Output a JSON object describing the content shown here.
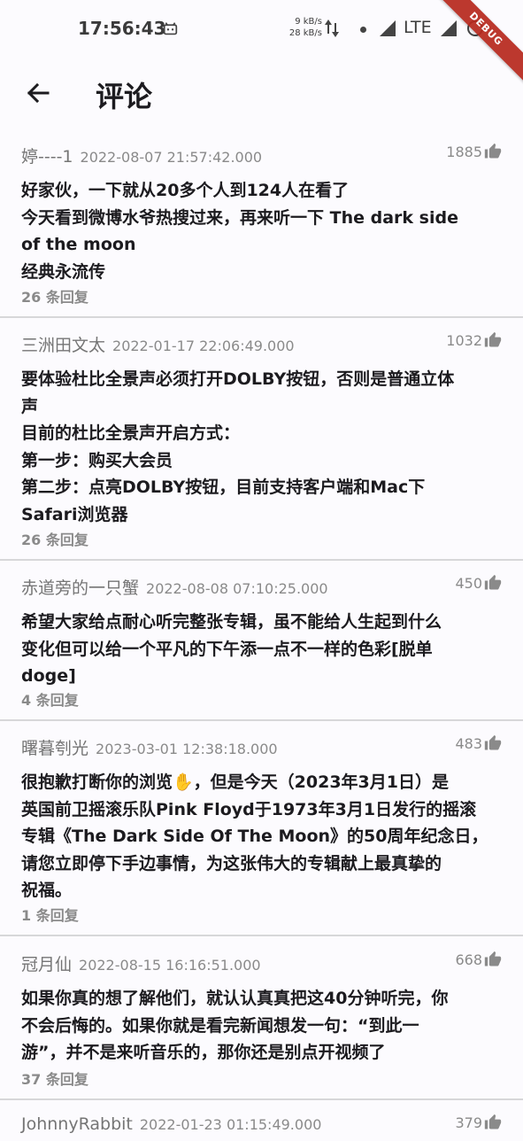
{
  "status_bar": {
    "time": "17:56:43",
    "speed_up": "9 kB/s",
    "speed_down": "28 kB/s",
    "network": "LTE"
  },
  "debug_banner": "DEBUG",
  "header": {
    "title": "评论"
  },
  "comments": [
    {
      "author": "婷----1",
      "date": "2022-08-07 21:57:42.000",
      "likes": "1885",
      "lines": [
        "好家伙，一下就从20多个人到124人在看了",
        "今天看到微博水爷热搜过来，再来听一下 The dark side",
        "of the moon",
        "经典永流传"
      ],
      "replies": "26 条回复"
    },
    {
      "author": "三洲田文太",
      "date": "2022-01-17 22:06:49.000",
      "likes": "1032",
      "lines": [
        "要体验杜比全景声必须打开DOLBY按钮，否则是普通立体",
        "声",
        "目前的杜比全景声开启方式：",
        "第一步：购买大会员",
        "第二步：点亮DOLBY按钮，目前支持客户端和Mac下",
        "Safari浏览器"
      ],
      "replies": "26 条回复"
    },
    {
      "author": "赤道旁的一只蟹",
      "date": "2022-08-08 07:10:25.000",
      "likes": "450",
      "lines": [
        "希望大家给点耐心听完整张专辑，虽不能给人生起到什么",
        "变化但可以给一个平凡的下午添一点不一样的色彩[脱单",
        "doge]"
      ],
      "replies": "4 条回复"
    },
    {
      "author": "曙暮刳光",
      "date": "2023-03-01 12:38:18.000",
      "likes": "483",
      "lines": [
        "很抱歉打断你的浏览✋，但是今天（2023年3月1日）是",
        "英国前卫摇滚乐队Pink Floyd于1973年3月1日发行的摇滚",
        "专辑《The Dark Side Of The Moon》的50周年纪念日，",
        "请您立即停下手边事情，为这张伟大的专辑献上最真挚的",
        "祝福。"
      ],
      "replies": "1 条回复"
    },
    {
      "author": "冠月仙",
      "date": "2022-08-15 16:16:51.000",
      "likes": "668",
      "lines": [
        "如果你真的想了解他们，就认认真真把这40分钟听完，你",
        "不会后悔的。如果你就是看完新闻想发一句：“到此一",
        "游”，并不是来听音乐的，那你还是别点开视频了"
      ],
      "replies": "37 条回复"
    },
    {
      "author": "JohnnyRabbit",
      "date": "2022-01-23 01:15:49.000",
      "likes": "379",
      "lines": [],
      "replies": ""
    }
  ]
}
